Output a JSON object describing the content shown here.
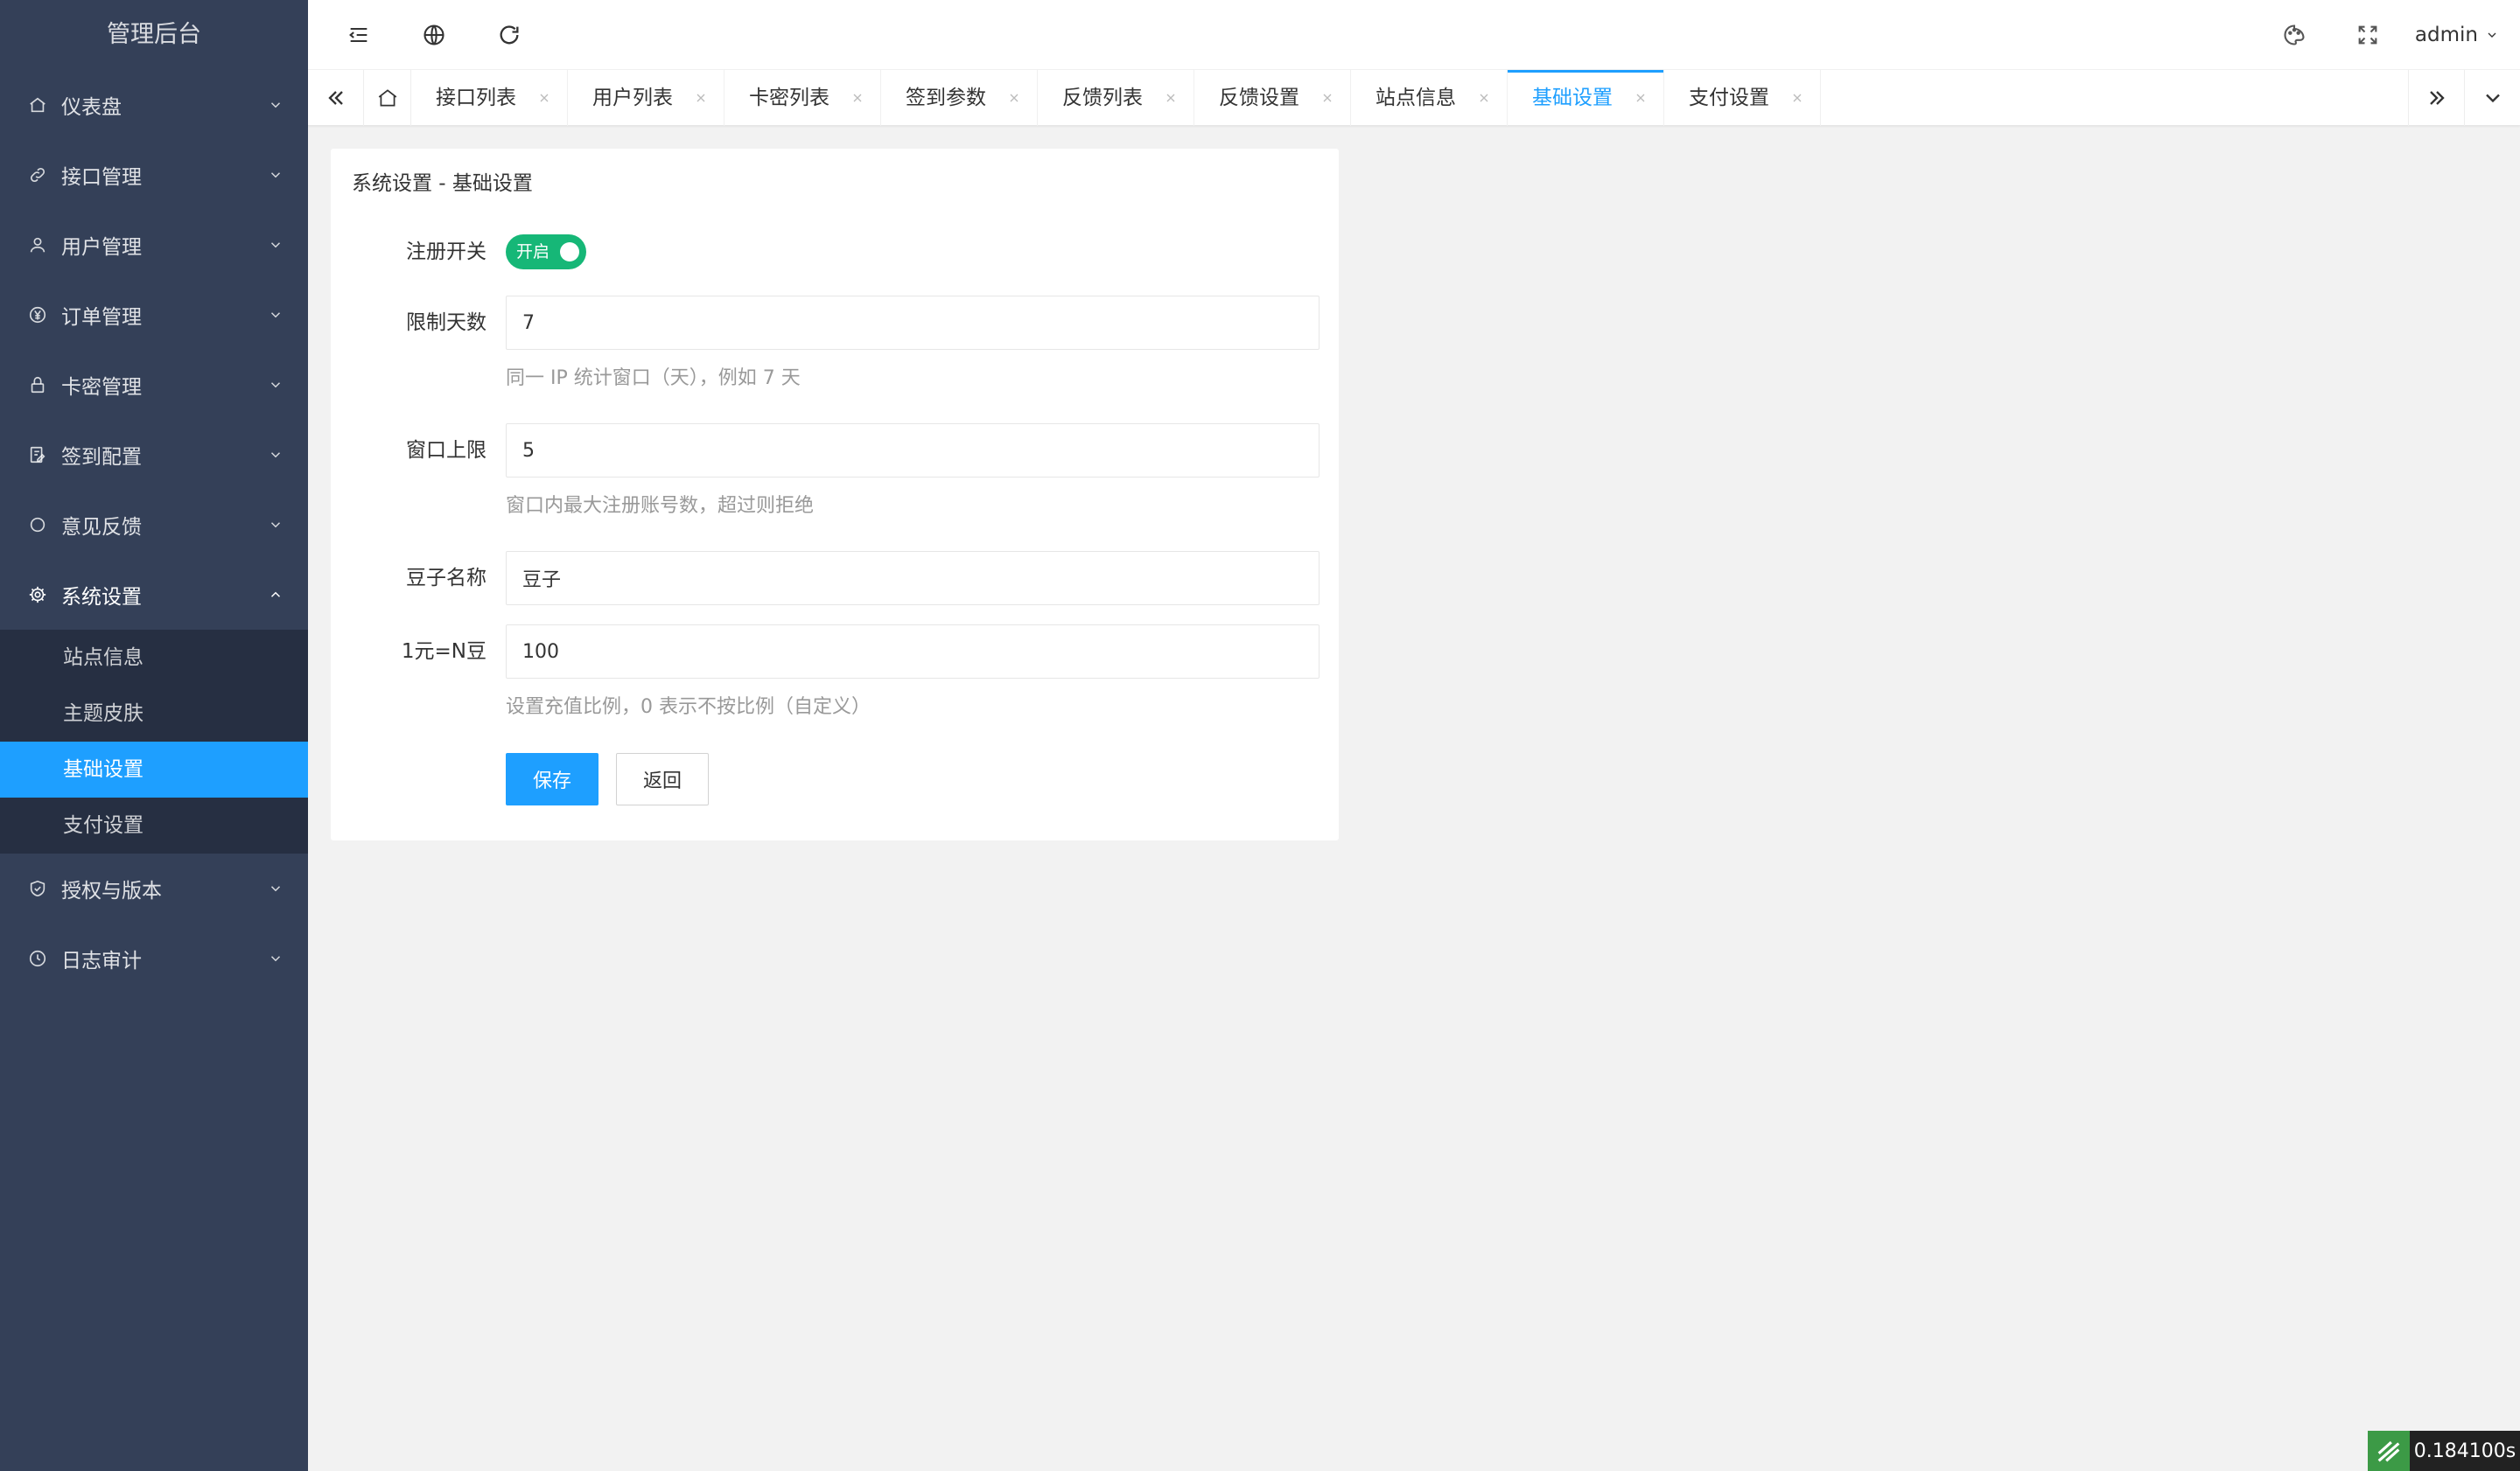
{
  "app": {
    "title": "管理后台"
  },
  "sidebar": {
    "items": [
      {
        "label": "仪表盘",
        "icon": "home-icon"
      },
      {
        "label": "接口管理",
        "icon": "link-icon"
      },
      {
        "label": "用户管理",
        "icon": "user-icon"
      },
      {
        "label": "订单管理",
        "icon": "yen-icon"
      },
      {
        "label": "卡密管理",
        "icon": "lock-icon"
      },
      {
        "label": "签到配置",
        "icon": "edit-icon"
      },
      {
        "label": "意见反馈",
        "icon": "circle-icon"
      },
      {
        "label": "系统设置",
        "icon": "gear-icon"
      },
      {
        "label": "授权与版本",
        "icon": "shield-icon"
      },
      {
        "label": "日志审计",
        "icon": "clock-icon"
      }
    ],
    "system_submenu": [
      "站点信息",
      "主题皮肤",
      "基础设置",
      "支付设置"
    ],
    "active_submenu": "基础设置"
  },
  "header": {
    "user": "admin"
  },
  "tabs": [
    {
      "label": "接口列表"
    },
    {
      "label": "用户列表"
    },
    {
      "label": "卡密列表"
    },
    {
      "label": "签到参数"
    },
    {
      "label": "反馈列表"
    },
    {
      "label": "反馈设置"
    },
    {
      "label": "站点信息"
    },
    {
      "label": "基础设置",
      "active": true
    },
    {
      "label": "支付设置"
    }
  ],
  "form": {
    "title": "系统设置 - 基础设置",
    "register_switch": {
      "label": "注册开关",
      "state_text": "开启",
      "on": true
    },
    "limit_days": {
      "label": "限制天数",
      "value": "7",
      "tip": "同一 IP 统计窗口（天），例如 7 天"
    },
    "window_limit": {
      "label": "窗口上限",
      "value": "5",
      "tip": "窗口内最大注册账号数，超过则拒绝"
    },
    "bean_name": {
      "label": "豆子名称",
      "value": "豆子"
    },
    "ratio": {
      "label": "1元=N豆",
      "value": "100",
      "tip": "设置充值比例，0 表示不按比例（自定义）"
    },
    "save_label": "保存",
    "back_label": "返回"
  },
  "timer": {
    "text": "0.184100s"
  },
  "colors": {
    "sidebar_bg": "#344058",
    "submenu_bg": "#262f42",
    "accent": "#1e9fff",
    "switch_on": "#16b777"
  }
}
